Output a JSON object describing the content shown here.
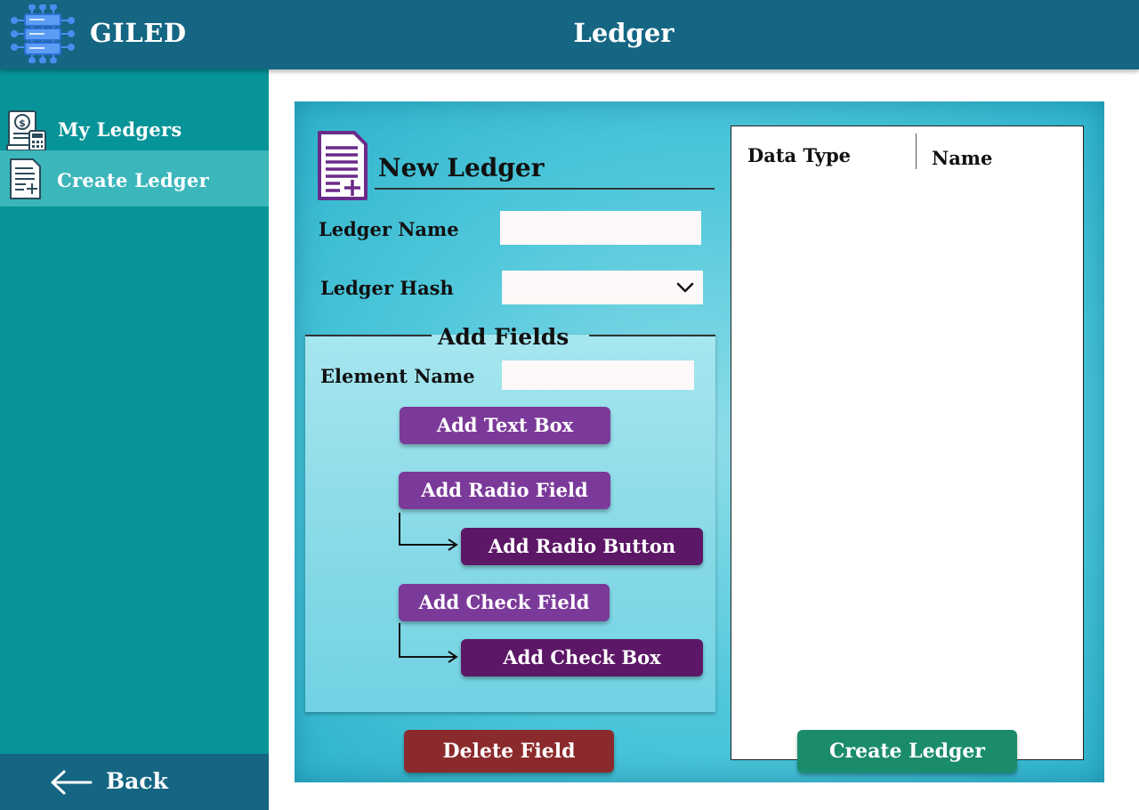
{
  "app": {
    "brand": "GILED",
    "logo_icon": "server-network-icon"
  },
  "header": {
    "title": "Ledger"
  },
  "sidebar": {
    "items": [
      {
        "label": "My Ledgers",
        "icon": "ledger-book-calculator-icon",
        "active": false
      },
      {
        "label": "Create Ledger",
        "icon": "add-document-icon",
        "active": true
      }
    ],
    "back": {
      "label": "Back",
      "icon": "arrow-left-icon"
    }
  },
  "form": {
    "title": "New Ledger",
    "title_icon": "add-document-icon",
    "ledger_name": {
      "label": "Ledger Name",
      "value": ""
    },
    "ledger_hash": {
      "label": "Ledger Hash",
      "value": "",
      "icon": "chevron-down-icon"
    },
    "add_fields": {
      "title": "Add Fields",
      "element_name": {
        "label": "Element Name",
        "value": ""
      },
      "buttons": {
        "add_text_box": "Add Text Box",
        "add_radio_field": "Add Radio Field",
        "add_radio_button": "Add Radio Button",
        "add_check_field": "Add Check Field",
        "add_check_box": "Add Check Box"
      }
    },
    "delete_field": "Delete Field"
  },
  "table": {
    "columns": [
      "Data Type",
      "Name"
    ],
    "rows": []
  },
  "actions": {
    "create_ledger": "Create Ledger"
  },
  "colors": {
    "header": "#146683",
    "sidebar": "#079498",
    "sidebar_active": "#3bb6ba",
    "button_purple": "#7b3a99",
    "button_dark_purple": "#5c1766",
    "delete_red": "#8b2a2c",
    "create_green": "#1b8c6b"
  }
}
